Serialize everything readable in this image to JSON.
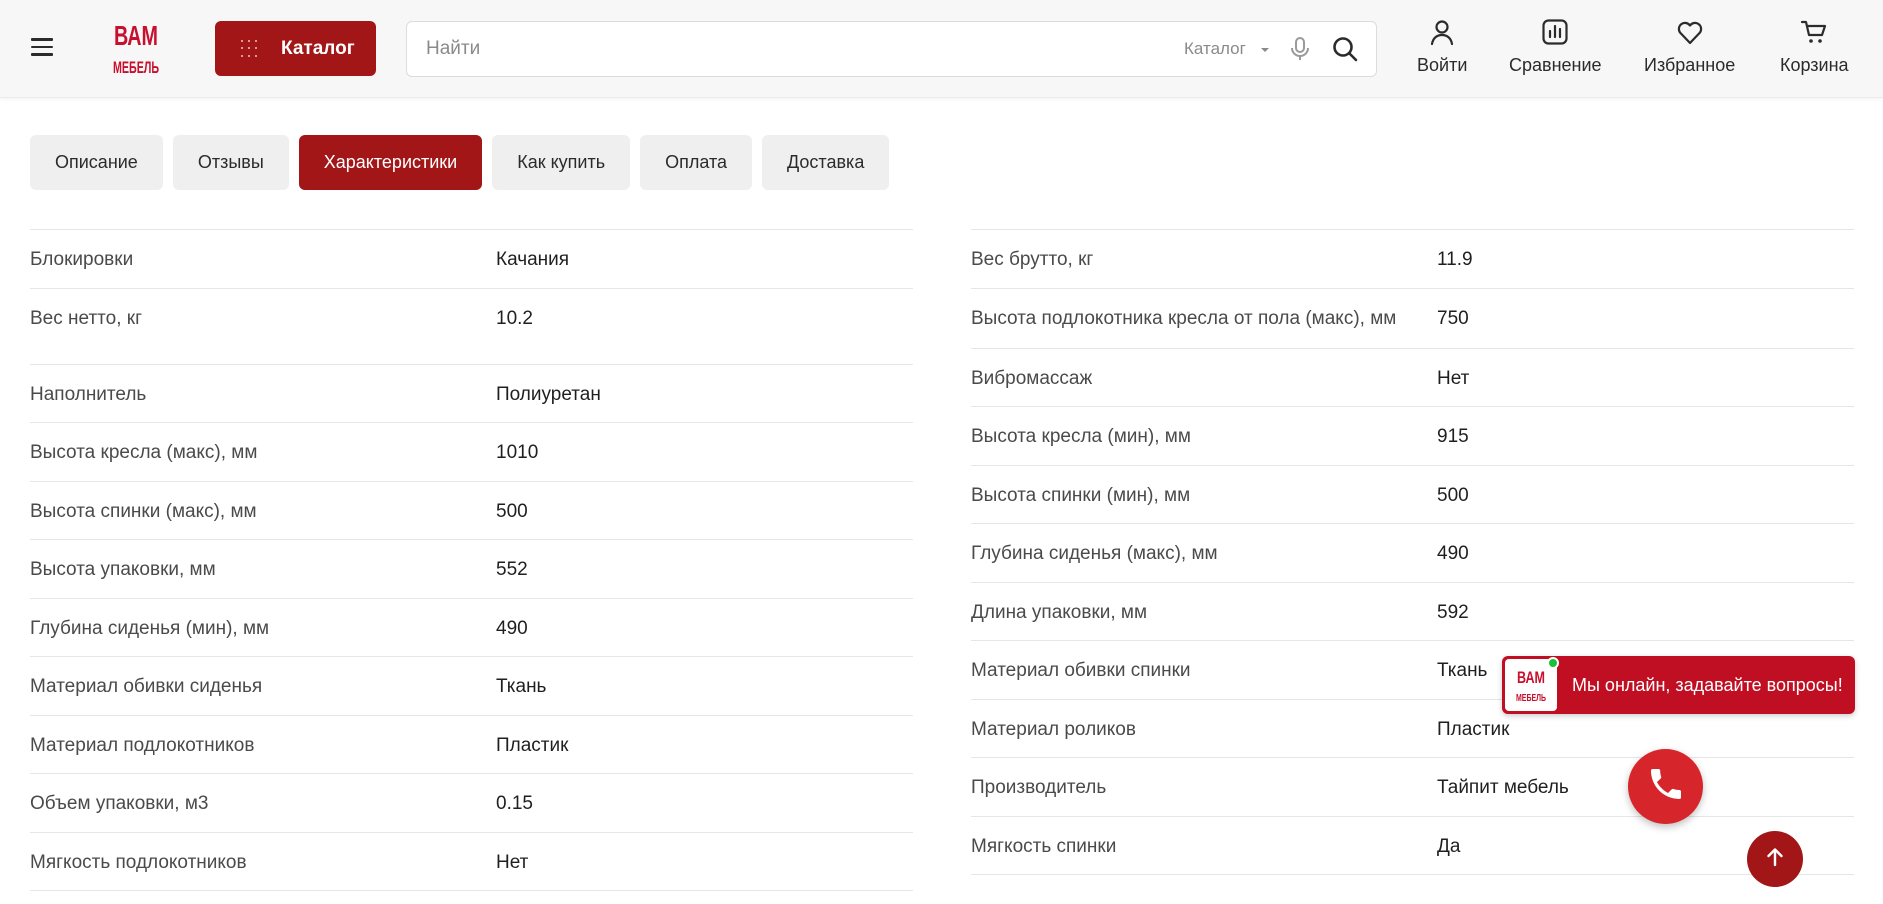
{
  "header": {
    "logo": {
      "line1": "ВАМ",
      "line2": "МЕБЕЛЬ"
    },
    "catalog_button": "Каталог",
    "search": {
      "placeholder": "Найти",
      "scope": "Каталог"
    },
    "nav": {
      "login": "Войти",
      "compare": "Сравнение",
      "favorites": "Избранное",
      "cart": "Корзина"
    }
  },
  "tabs": [
    {
      "label": "Описание",
      "active": false
    },
    {
      "label": "Отзывы",
      "active": false
    },
    {
      "label": "Характеристики",
      "active": true
    },
    {
      "label": "Как купить",
      "active": false
    },
    {
      "label": "Оплата",
      "active": false
    },
    {
      "label": "Доставка",
      "active": false
    }
  ],
  "specs_left": [
    {
      "key": "Блокировки",
      "value": "Качания"
    },
    {
      "key": "Вес нетто, кг",
      "value": "10.2"
    },
    {
      "key": "Наполнитель",
      "value": "Полиуретан"
    },
    {
      "key": "Высота кресла (макс), мм",
      "value": "1010"
    },
    {
      "key": "Высота спинки (макс), мм",
      "value": "500"
    },
    {
      "key": "Высота упаковки, мм",
      "value": "552"
    },
    {
      "key": "Глубина сиденья (мин), мм",
      "value": "490"
    },
    {
      "key": "Материал обивки сиденья",
      "value": "Ткань"
    },
    {
      "key": "Материал подлокотников",
      "value": "Пластик"
    },
    {
      "key": "Объем упаковки, м3",
      "value": "0.15"
    },
    {
      "key": "Мягкость подлокотников",
      "value": "Нет"
    }
  ],
  "specs_right": [
    {
      "key": "Вес брутто, кг",
      "value": "11.9"
    },
    {
      "key": "Высота подлокотника кресла от пола (макс), мм",
      "value": "750"
    },
    {
      "key": "Вибромассаж",
      "value": "Нет"
    },
    {
      "key": "Высота кресла (мин), мм",
      "value": "915"
    },
    {
      "key": "Высота спинки (мин), мм",
      "value": "500"
    },
    {
      "key": "Глубина сиденья (макс), мм",
      "value": "490"
    },
    {
      "key": "Длина упаковки, мм",
      "value": "592"
    },
    {
      "key": "Материал обивки спинки",
      "value": "Ткань"
    },
    {
      "key": "Материал роликов",
      "value": "Пластик"
    },
    {
      "key": "Производитель",
      "value": "Тайпит мебель"
    },
    {
      "key": "Мягкость спинки",
      "value": "Да"
    }
  ],
  "chat_widget": {
    "text": "Мы онлайн, задавайте вопросы!"
  },
  "colors": {
    "brand_red": "#a31618",
    "chat_red": "#c00f23",
    "call_red": "#d6262b",
    "online_green": "#1bbf3a"
  },
  "icons": [
    "menu-icon",
    "grid-dots-icon",
    "caret-down-icon",
    "microphone-icon",
    "search-icon",
    "user-icon",
    "compare-chart-icon",
    "heart-icon",
    "cart-icon",
    "phone-icon",
    "arrow-up-icon"
  ]
}
